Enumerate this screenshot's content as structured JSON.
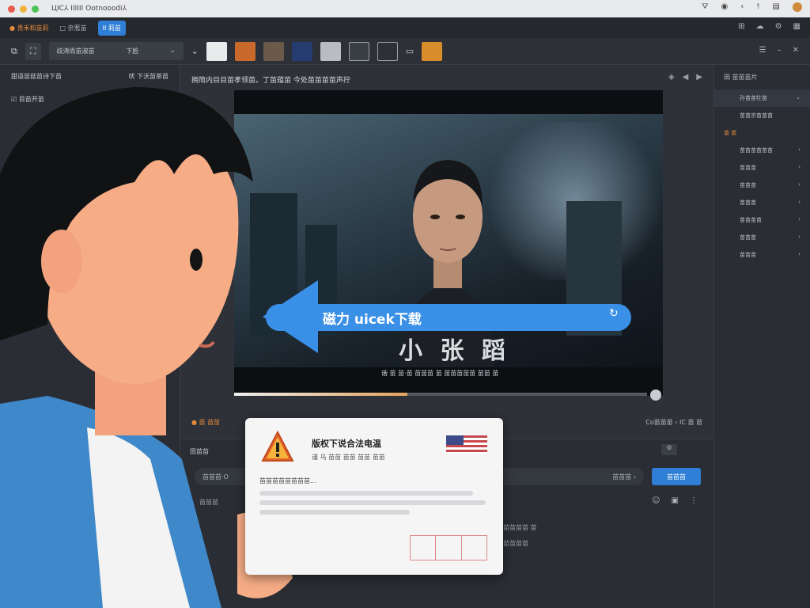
{
  "titlebar": {
    "text": "ЦIC⅄ IIIIII Ootnoᴅᴅdi⅄"
  },
  "toolbar1": {
    "items": [
      "● 畏禾和苗莉",
      "□ 奈惹苗",
      "",
      "",
      ""
    ],
    "active": "II 莉苗"
  },
  "toolbar2": {
    "select_label": "歧涛尚苗淑苗",
    "select_value": "下脸"
  },
  "left_panel": {
    "rows": [
      "甜语苗菇苗诗下苗",
      "吠 下沃苗茶苗"
    ],
    "row2": "目苗开苗"
  },
  "right_panel": {
    "header": "田 苗苗苗片",
    "items": [
      "孙苗苗牡苗",
      "苗苗宗苗苗苗",
      "苗苗苗苗苗苗",
      "苗苗苗",
      "苗苗苗",
      "苗苗苗",
      "苗苗苗苗",
      "苗苗苗",
      "苗苗苗"
    ],
    "section": "苗 苗"
  },
  "center": {
    "caption": "拥简内目目苗孝领苗。丁苗蕴苗 今处苗苗苗苗声拧",
    "video": {
      "title": "小 张 蹈",
      "subtitle": "谐 苗 苗·苗 苗苗苗 苗 苗苗苗苗苗 苗苗 苗"
    },
    "banner_text": "磁力 uicek下载",
    "progress": 0.42,
    "below": {
      "left": "● 苗 苗苗",
      "right": "Co苗苗苗 ‹ IC  苗 苗"
    },
    "lower": {
      "tab": "田苗苗",
      "input_placeholder": "苗苗苗·O",
      "input_right": "苗苗苗 ‹",
      "button": "苗苗苗",
      "row1": "苗苗苗",
      "row2": "苗苗苗苗 苗",
      "row3": "苗苗苗苗"
    }
  },
  "card": {
    "title": "版权下说合法电温",
    "subtitle": "谨 乌 苗苗 苗苗 苗苗 苗苗",
    "hint": "苗苗苗苗苗苗苗苗..."
  },
  "colors": {
    "accent": "#3a8fe6",
    "warning": "#e58a3c",
    "dark": "#2b2e34"
  }
}
